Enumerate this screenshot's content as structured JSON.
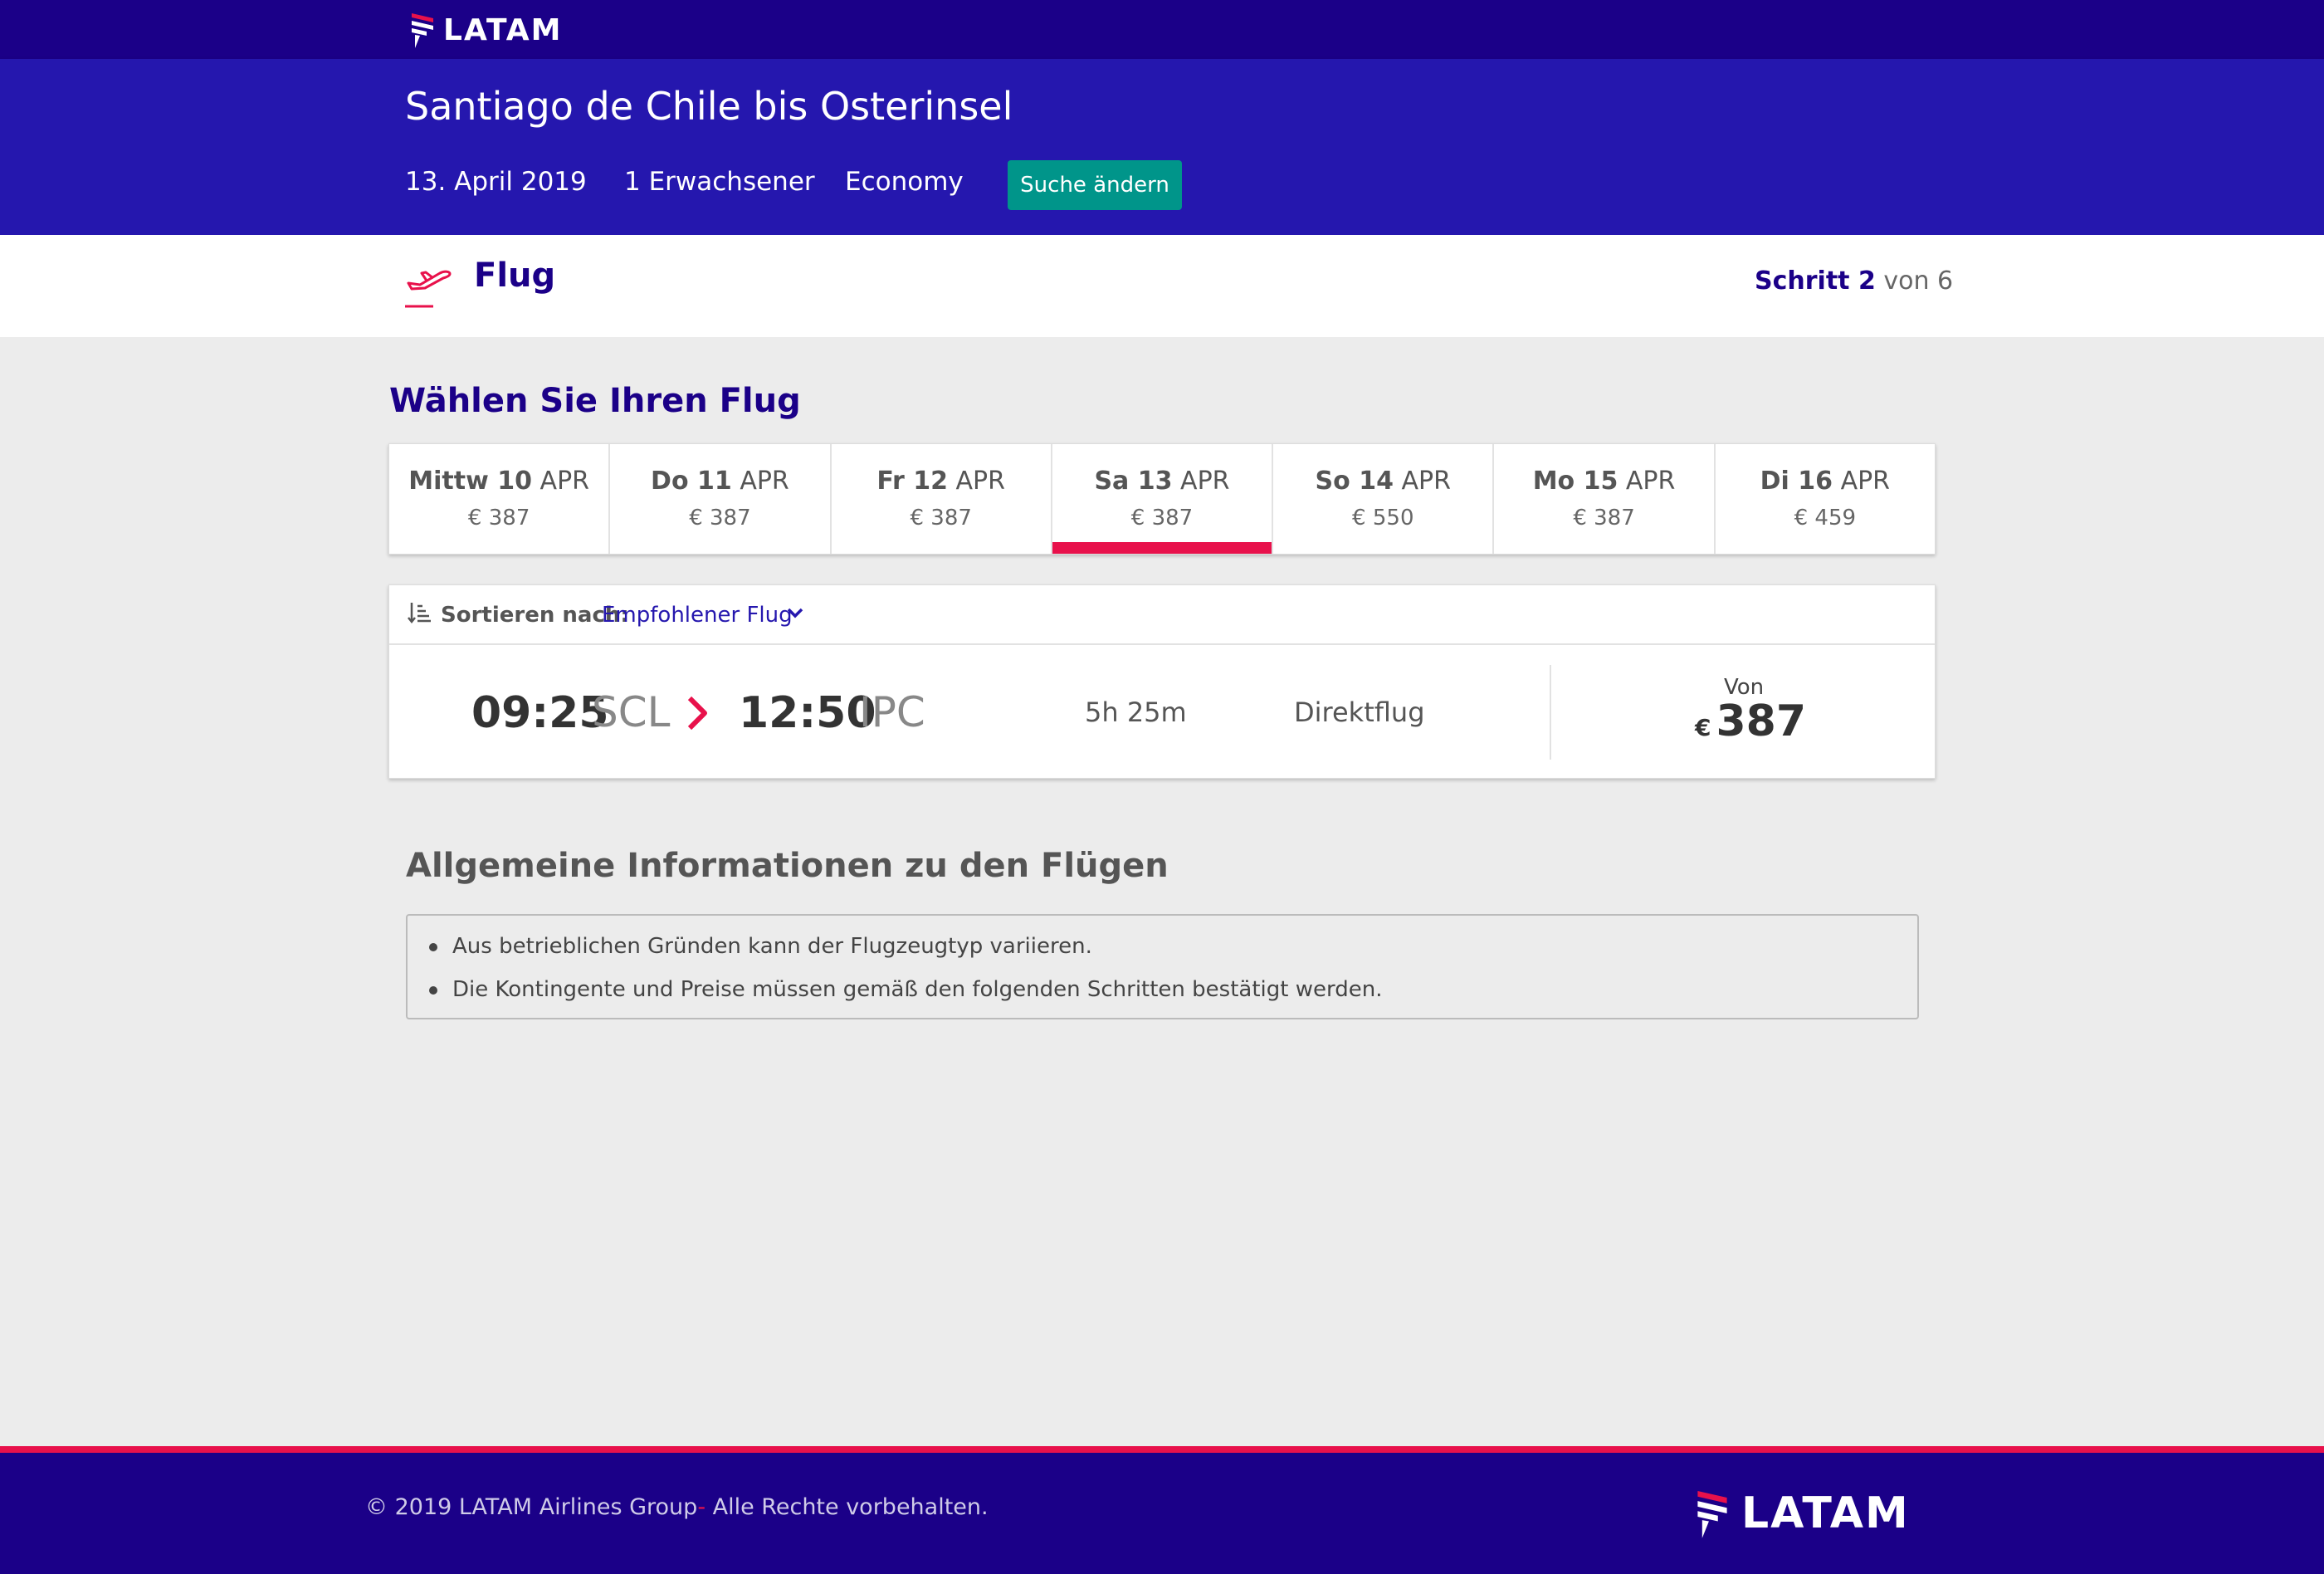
{
  "brand": {
    "name": "LATAM",
    "logo_icon": "latam-logo-icon",
    "accent": "#e8114b",
    "primary": "#1b0088",
    "teal": "#00958a"
  },
  "search": {
    "route": "Santiago de Chile bis Osterinsel",
    "date": "13. April 2019",
    "passengers": "1 Erwachsener",
    "cabin": "Economy",
    "change_button": "Suche ändern"
  },
  "step": {
    "icon": "airplane-takeoff-icon",
    "title": "Flug",
    "label": "Schritt 2",
    "of": "von 6"
  },
  "section_title": "Wählen Sie Ihren Flug",
  "dates": [
    {
      "day": "Mittw 10",
      "month": "APR",
      "price": "€ 387",
      "selected": false
    },
    {
      "day": "Do 11",
      "month": "APR",
      "price": "€ 387",
      "selected": false
    },
    {
      "day": "Fr 12",
      "month": "APR",
      "price": "€ 387",
      "selected": false
    },
    {
      "day": "Sa 13",
      "month": "APR",
      "price": "€ 387",
      "selected": true
    },
    {
      "day": "So 14",
      "month": "APR",
      "price": "€ 550",
      "selected": false
    },
    {
      "day": "Mo 15",
      "month": "APR",
      "price": "€ 387",
      "selected": false
    },
    {
      "day": "Di 16",
      "month": "APR",
      "price": "€ 459",
      "selected": false
    }
  ],
  "sort": {
    "icon": "sort-icon",
    "label": "Sortieren nach:",
    "value": "Empfohlener Flug"
  },
  "flight": {
    "departure_time": "09:25",
    "departure_code": "SCL",
    "arrival_time": "12:50",
    "arrival_code": "IPC",
    "duration": "5h 25m",
    "stops": "Direktflug",
    "from_label": "Von",
    "currency": "€",
    "price": "387"
  },
  "info": {
    "title": "Allgemeine Informationen zu den Flügen",
    "items": [
      "Aus betrieblichen Gründen kann der Flugzeugtyp variieren.",
      "Die Kontingente und Preise müssen gemäß den folgenden Schritten bestätigt werden."
    ]
  },
  "footer": {
    "copyright_prefix": "© 2019 LATAM Airlines Group",
    "copyright_dash": "-",
    "copyright_suffix": " Alle Rechte vorbehalten."
  }
}
